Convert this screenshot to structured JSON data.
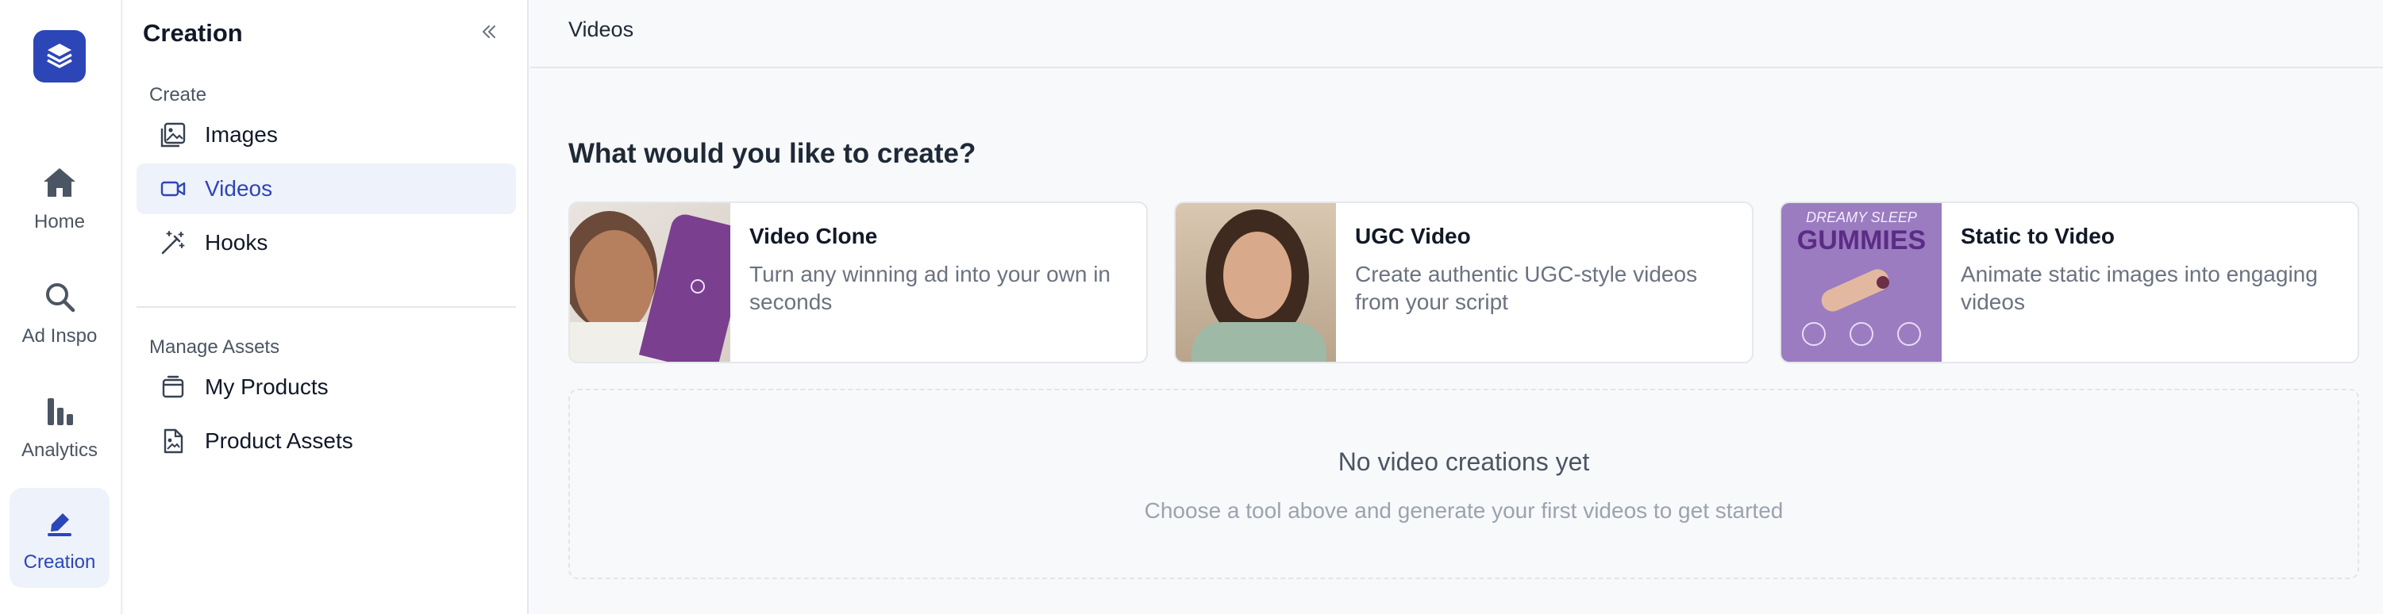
{
  "rail": {
    "items": [
      {
        "label": "Home",
        "icon": "home-icon"
      },
      {
        "label": "Ad Inspo",
        "icon": "search-icon"
      },
      {
        "label": "Analytics",
        "icon": "bar-chart-icon"
      },
      {
        "label": "Creation",
        "icon": "pen-icon",
        "active": true
      }
    ]
  },
  "sidebar": {
    "title": "Creation",
    "create_label": "Create",
    "create_items": [
      {
        "label": "Images",
        "icon": "image-icon"
      },
      {
        "label": "Videos",
        "icon": "video-icon",
        "active": true
      },
      {
        "label": "Hooks",
        "icon": "magic-wand-icon"
      }
    ],
    "assets_label": "Manage Assets",
    "asset_items": [
      {
        "label": "My Products",
        "icon": "package-icon"
      },
      {
        "label": "Product Assets",
        "icon": "file-image-icon"
      }
    ]
  },
  "topbar": {
    "title": "Videos"
  },
  "main": {
    "heading": "What would you like to create?",
    "cards": [
      {
        "title": "Video Clone",
        "description": "Turn any winning ad into your own in seconds"
      },
      {
        "title": "UGC Video",
        "description": "Create authentic UGC-style videos from your script"
      },
      {
        "title": "Static to Video",
        "description": "Animate static images into engaging videos",
        "thumb_text_top": "DREAMY SLEEP",
        "thumb_text_main": "GUMMIES"
      }
    ],
    "empty": {
      "title": "No video creations yet",
      "subtitle": "Choose a tool above and generate your first videos to get started"
    }
  },
  "colors": {
    "accent": "#2c46b8",
    "active_bg": "#eef2fb",
    "gummy_bg": "#9b7cc1"
  }
}
